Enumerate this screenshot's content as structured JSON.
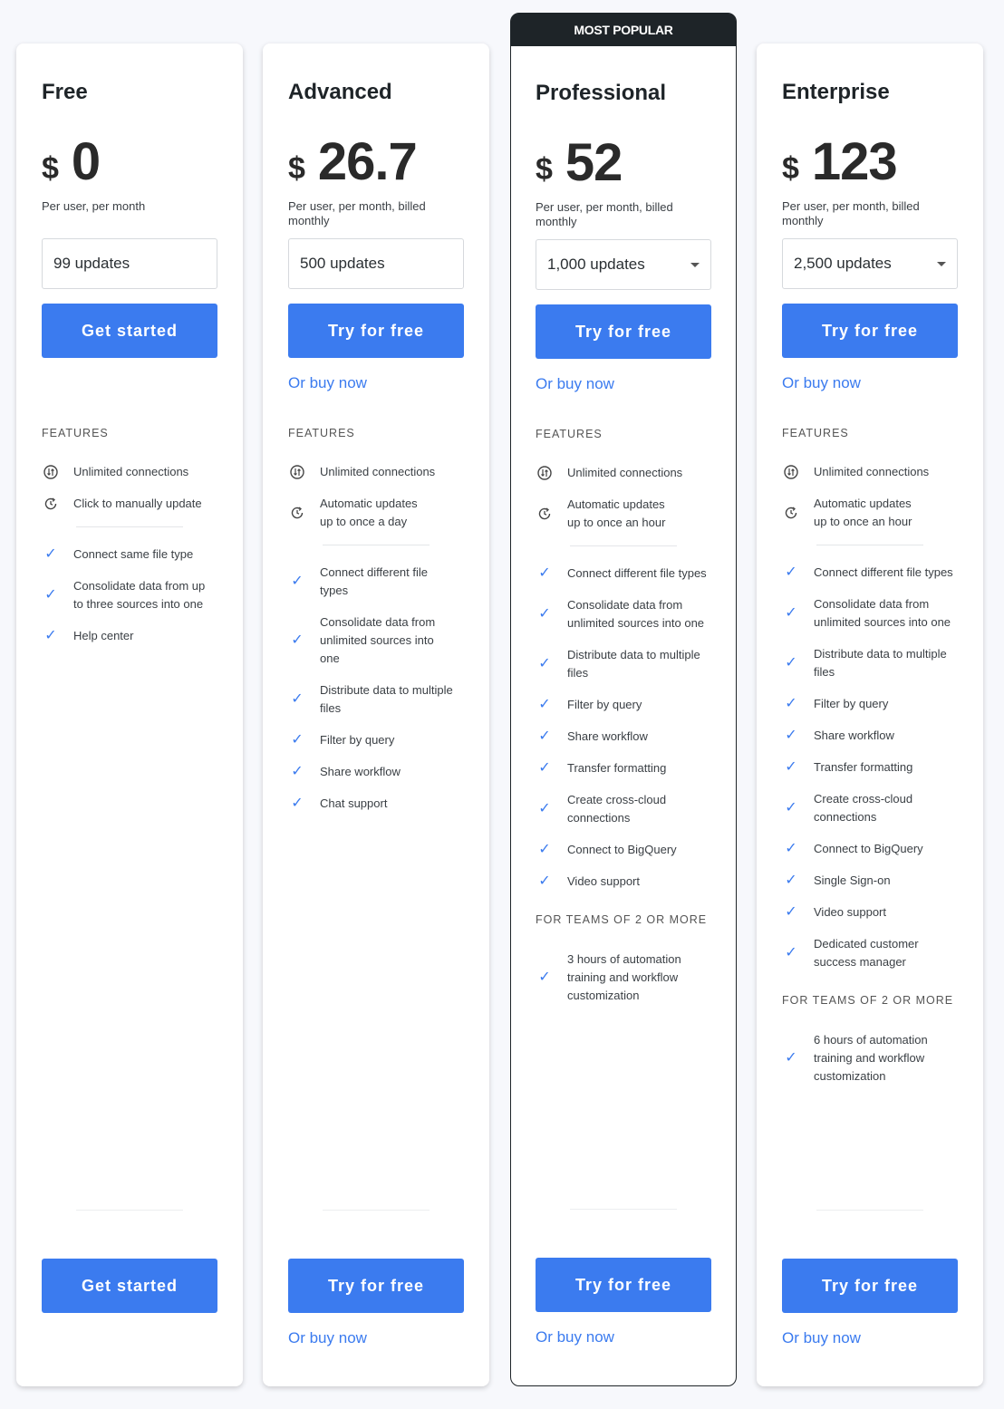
{
  "accent": "#3b7bef",
  "plans": [
    {
      "name": "Free",
      "currency": "$",
      "price": "0",
      "period": "Per user, per month",
      "updates": "99 updates",
      "dropdown": false,
      "cta": "Get started",
      "buy": "",
      "features_label": "FEATURES",
      "core": [
        {
          "icon": "exchange-icon",
          "text": "Unlimited connections"
        },
        {
          "icon": "refresh-clock-icon",
          "text": "Click to manually update"
        }
      ],
      "features": [
        "Connect same file type",
        "Consolidate data from up to three sources into one",
        "Help center"
      ],
      "teams_label": "",
      "teams": []
    },
    {
      "name": "Advanced",
      "currency": "$",
      "price": "26.7",
      "period": "Per user, per month, billed monthly",
      "updates": "500 updates",
      "dropdown": false,
      "cta": "Try for free",
      "buy": "Or buy now",
      "features_label": "FEATURES",
      "core": [
        {
          "icon": "exchange-icon",
          "text": "Unlimited connections"
        },
        {
          "icon": "refresh-clock-icon",
          "text": "Automatic updates up to once a day"
        }
      ],
      "features": [
        "Connect different file types",
        "Consolidate data from unlimited sources into one",
        "Distribute data to multiple files",
        "Filter by query",
        "Share workflow",
        "Chat support"
      ],
      "teams_label": "",
      "teams": []
    },
    {
      "name": "Professional",
      "badge": "MOST POPULAR",
      "currency": "$",
      "price": "52",
      "period": "Per user, per month, billed monthly",
      "updates": "1,000 updates",
      "dropdown": true,
      "cta": "Try for free",
      "buy": "Or buy now",
      "features_label": "FEATURES",
      "core": [
        {
          "icon": "exchange-icon",
          "text": "Unlimited connections"
        },
        {
          "icon": "refresh-clock-icon",
          "text": "Automatic updates up to once an hour"
        }
      ],
      "features": [
        "Connect different file types",
        "Consolidate data from unlimited sources into one",
        "Distribute data to multiple files",
        "Filter by query",
        "Share workflow",
        "Transfer formatting",
        "Create cross-cloud connections",
        "Connect to BigQuery",
        "Video support"
      ],
      "teams_label": "FOR TEAMS OF 2 OR MORE",
      "teams": [
        "3 hours of automation training and workflow customization"
      ]
    },
    {
      "name": "Enterprise",
      "currency": "$",
      "price": "123",
      "period": "Per user, per month, billed monthly",
      "updates": "2,500 updates",
      "dropdown": true,
      "cta": "Try for free",
      "buy": "Or buy now",
      "features_label": "FEATURES",
      "core": [
        {
          "icon": "exchange-icon",
          "text": "Unlimited connections"
        },
        {
          "icon": "refresh-clock-icon",
          "text": "Automatic updates up to once an hour"
        }
      ],
      "features": [
        "Connect different file types",
        "Consolidate data from unlimited sources into one",
        "Distribute data to multiple files",
        "Filter by query",
        "Share workflow",
        "Transfer formatting",
        "Create cross-cloud connections",
        "Connect to BigQuery",
        "Single Sign-on",
        "Video support",
        "Dedicated customer success manager"
      ],
      "teams_label": "FOR TEAMS OF 2 OR MORE",
      "teams": [
        "6 hours of automation training and workflow customization"
      ]
    }
  ]
}
